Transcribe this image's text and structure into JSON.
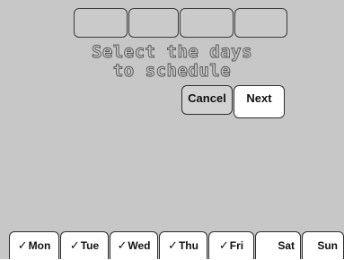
{
  "prompt": {
    "line1": "Select the days",
    "line2": "to schedule"
  },
  "buttons": {
    "cancel_label": "Cancel",
    "next_label": "Next"
  },
  "days": [
    {
      "label": "Mon",
      "checked": true,
      "check_icon": "checkmark-icon",
      "check_glyph": "✓"
    },
    {
      "label": "Tue",
      "checked": true,
      "check_icon": "checkmark-icon",
      "check_glyph": "✓"
    },
    {
      "label": "Wed",
      "checked": true,
      "check_icon": "checkmark-icon",
      "check_glyph": "✓"
    },
    {
      "label": "Thu",
      "checked": true,
      "check_icon": "checkmark-icon",
      "check_glyph": "✓"
    },
    {
      "label": "Fri",
      "checked": true,
      "check_icon": "checkmark-icon",
      "check_glyph": "✓"
    },
    {
      "label": "Sat",
      "checked": false
    },
    {
      "label": "Sun",
      "checked": false
    }
  ],
  "colors": {
    "screen_bg": "#c7c7c7",
    "border": "#2e2e2e",
    "button_active": "#ffffff",
    "button_inactive": "#d2d2d2"
  }
}
